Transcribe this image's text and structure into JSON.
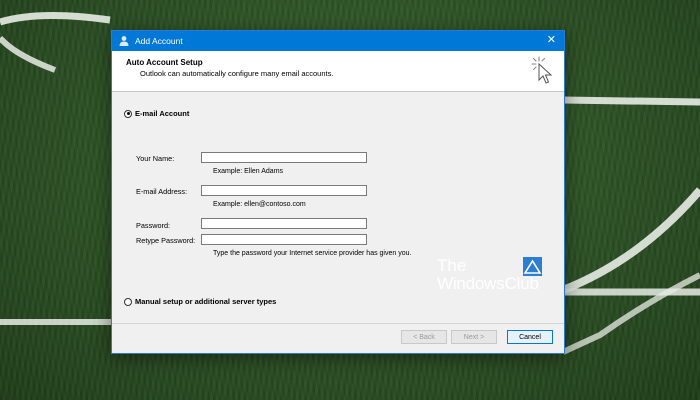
{
  "window": {
    "title": "Add Account",
    "close_glyph": "✕"
  },
  "header": {
    "title": "Auto Account Setup",
    "subtitle": "Outlook can automatically configure many email accounts.",
    "icon": "wizard-cursor-icon"
  },
  "options": {
    "email_account": {
      "label": "E-mail Account",
      "selected": true
    },
    "manual_setup": {
      "label": "Manual setup or additional server types",
      "selected": false
    }
  },
  "form": {
    "name": {
      "label": "Your Name:",
      "value": "",
      "hint": "Example: Ellen Adams"
    },
    "email": {
      "label": "E-mail Address:",
      "value": "",
      "hint": "Example: ellen@contoso.com"
    },
    "password": {
      "label": "Password:",
      "value": ""
    },
    "retype_password": {
      "label": "Retype Password:",
      "value": ""
    },
    "password_hint": "Type the password your Internet service provider has given you."
  },
  "buttons": {
    "back": {
      "label": "< Back",
      "enabled": false
    },
    "next": {
      "label": "Next >",
      "enabled": false
    },
    "cancel": {
      "label": "Cancel",
      "enabled": true
    }
  },
  "watermark": {
    "line1": "The",
    "line2": "WindowsClub"
  },
  "colors": {
    "title_bar": "#0078d7",
    "dialog_bg": "#f0f0f0",
    "logo_blue": "#2a7fd4"
  }
}
